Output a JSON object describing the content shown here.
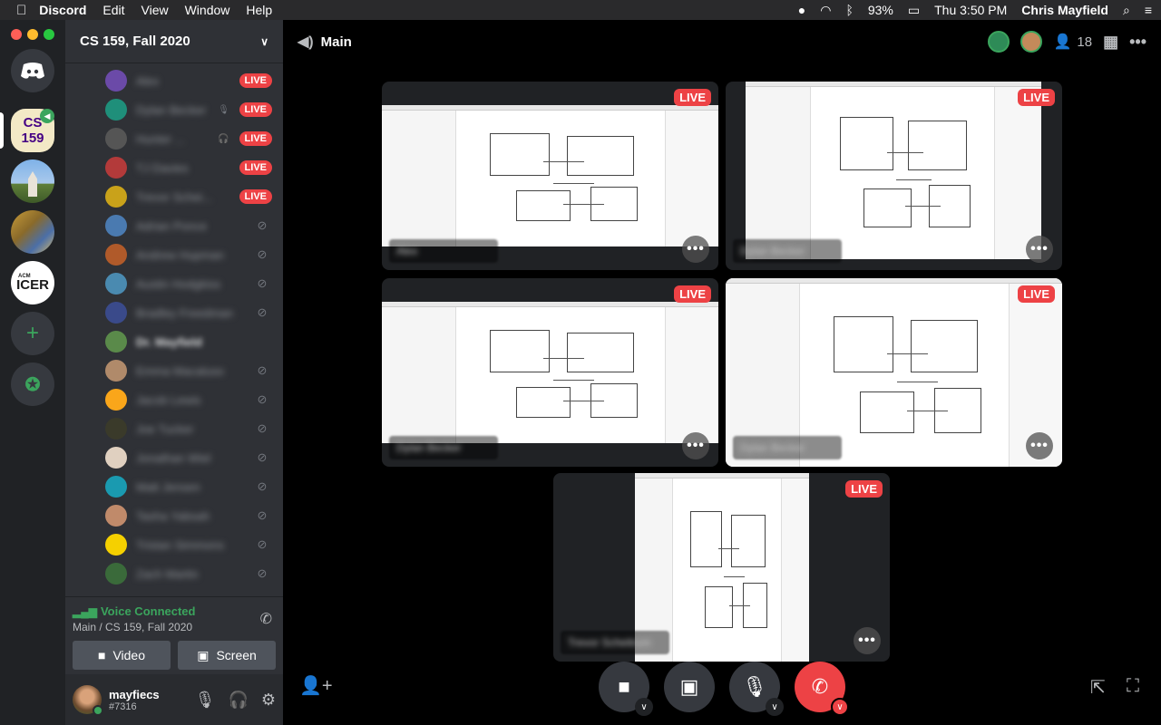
{
  "menubar": {
    "app": "Discord",
    "items": [
      "Edit",
      "View",
      "Window",
      "Help"
    ],
    "battery": "93%",
    "clock": "Thu 3:50 PM",
    "user": "Chris Mayfield"
  },
  "guilds": {
    "cs_label": "CS\n159",
    "icer_label": "ICER",
    "icer_small": "ACM"
  },
  "channel_sidebar": {
    "server_name": "CS 159, Fall 2020",
    "members": [
      {
        "name": "Alex",
        "live": "LIVE"
      },
      {
        "name": "Dylan Becker",
        "live": "LIVE"
      },
      {
        "name": "Hunter ...",
        "live": "LIVE"
      },
      {
        "name": "TJ Davies",
        "live": "LIVE"
      },
      {
        "name": "Trevor Schei...",
        "live": "LIVE"
      },
      {
        "name": "Adrian Ponce"
      },
      {
        "name": "Andrew Hupman"
      },
      {
        "name": "Austin Hodgkiss"
      },
      {
        "name": "Bradley Freedman"
      },
      {
        "name": "Dr. Mayfield"
      },
      {
        "name": "Emma Macaluso"
      },
      {
        "name": "Jacob Lewis"
      },
      {
        "name": "Joe Tucker"
      },
      {
        "name": "Jonathan Wiel"
      },
      {
        "name": "Matt Jensen"
      },
      {
        "name": "Tasha Yabsah"
      },
      {
        "name": "Tristan Simmons"
      },
      {
        "name": "Zach Martin"
      }
    ]
  },
  "voice": {
    "status": "Voice Connected",
    "location": "Main / CS 159, Fall 2020",
    "video_label": "Video",
    "screen_label": "Screen"
  },
  "user": {
    "name": "mayfiecs",
    "tag": "#7316"
  },
  "main": {
    "channel": "Main",
    "participant_count": "18",
    "tiles": [
      {
        "live": "LIVE",
        "name": "Alex",
        "more": "•••"
      },
      {
        "live": "LIVE",
        "name": "Dylan Becker",
        "more": "•••"
      },
      {
        "live": "LIVE",
        "name": "Dylan Becker",
        "more": "•••"
      },
      {
        "live": "LIVE",
        "name": "Dylan Becker",
        "more": "•••"
      },
      {
        "live": "LIVE",
        "name": "Trevor Scheitrum",
        "more": "•••"
      }
    ]
  },
  "colors": {
    "live": "#ed4245",
    "voice_connected": "#3ba55d",
    "sidebar": "#2f3136",
    "guild_bar": "#202225",
    "hangup": "#ed4245"
  }
}
